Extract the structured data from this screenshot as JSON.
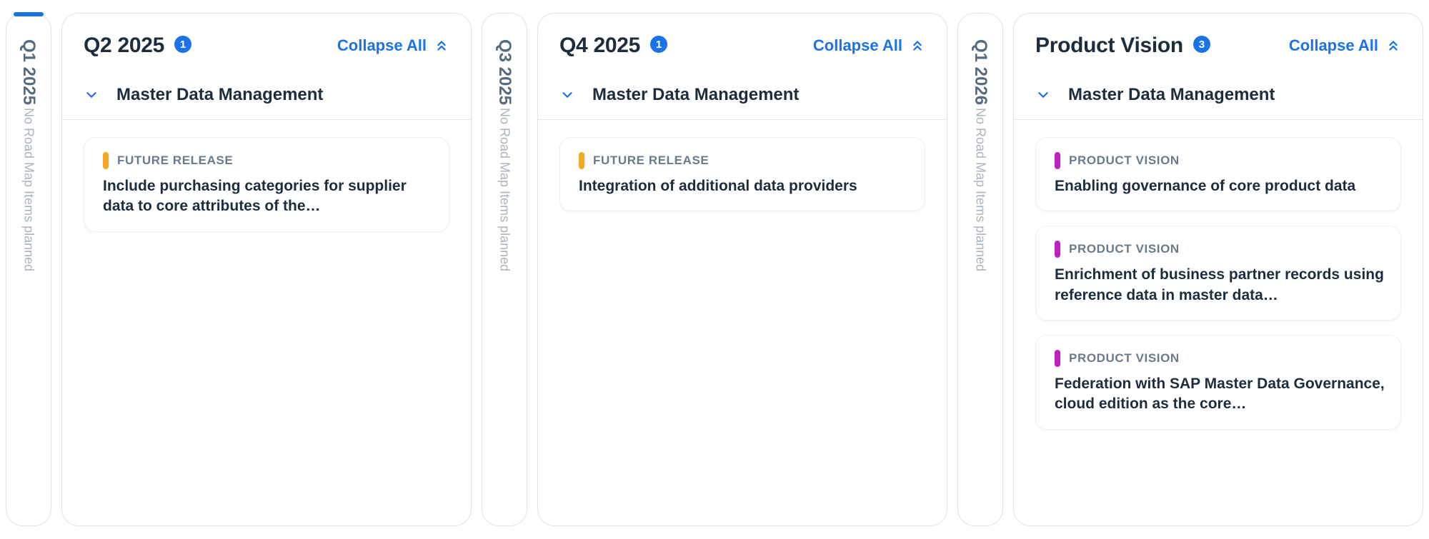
{
  "common": {
    "collapse_all": "Collapse All",
    "empty_caption": "No Road Map Items planned"
  },
  "columns": [
    {
      "kind": "collapsed",
      "title": "Q1 2025",
      "active_bar": true
    },
    {
      "kind": "main",
      "title": "Q2 2025",
      "count": "1",
      "section_title": "Master Data Management",
      "cards": [
        {
          "tag_label": "FUTURE RELEASE",
          "pill_class": "pill-future",
          "title": "Include purchasing categories for supplier data to core attributes of the…"
        }
      ]
    },
    {
      "kind": "collapsed",
      "title": "Q3 2025",
      "active_bar": false
    },
    {
      "kind": "main",
      "title": "Q4 2025",
      "count": "1",
      "section_title": "Master Data Management",
      "cards": [
        {
          "tag_label": "FUTURE RELEASE",
          "pill_class": "pill-future",
          "title": "Integration of additional data providers"
        }
      ]
    },
    {
      "kind": "collapsed",
      "title": "Q1 2026",
      "active_bar": false
    },
    {
      "kind": "main",
      "title": "Product Vision",
      "count": "3",
      "section_title": "Master Data Management",
      "cards": [
        {
          "tag_label": "PRODUCT VISION",
          "pill_class": "pill-vision",
          "title": "Enabling governance of core product data"
        },
        {
          "tag_label": "PRODUCT VISION",
          "pill_class": "pill-vision",
          "title": "Enrichment of business partner records using reference data in master data…"
        },
        {
          "tag_label": "PRODUCT VISION",
          "pill_class": "pill-vision",
          "title": "Federation with SAP Master Data Governance, cloud edition as the core…"
        }
      ]
    }
  ]
}
